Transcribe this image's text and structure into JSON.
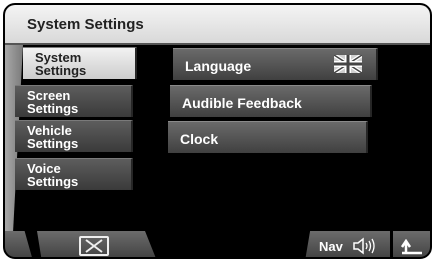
{
  "window": {
    "title": "System Settings"
  },
  "sidebar": {
    "items": [
      {
        "label": "System\nSettings",
        "active": true
      },
      {
        "label": "Screen\nSettings",
        "active": false
      },
      {
        "label": "Vehicle\nSettings",
        "active": false
      },
      {
        "label": "Voice\nSettings",
        "active": false
      }
    ]
  },
  "main": {
    "options": [
      {
        "label": "Language",
        "icon": "uk-flag-icon"
      },
      {
        "label": "Audible Feedback"
      },
      {
        "label": "Clock"
      }
    ]
  },
  "bottom": {
    "close_icon": "close-icon",
    "nav_label": "Nav",
    "speaker_icon": "speaker-icon",
    "back_icon": "back-arrow-icon"
  },
  "colors": {
    "background": "#000000",
    "button": "#4a4a4a",
    "active_button": "#e0e0e0",
    "text_light": "#ffffff",
    "text_dark": "#222222"
  }
}
